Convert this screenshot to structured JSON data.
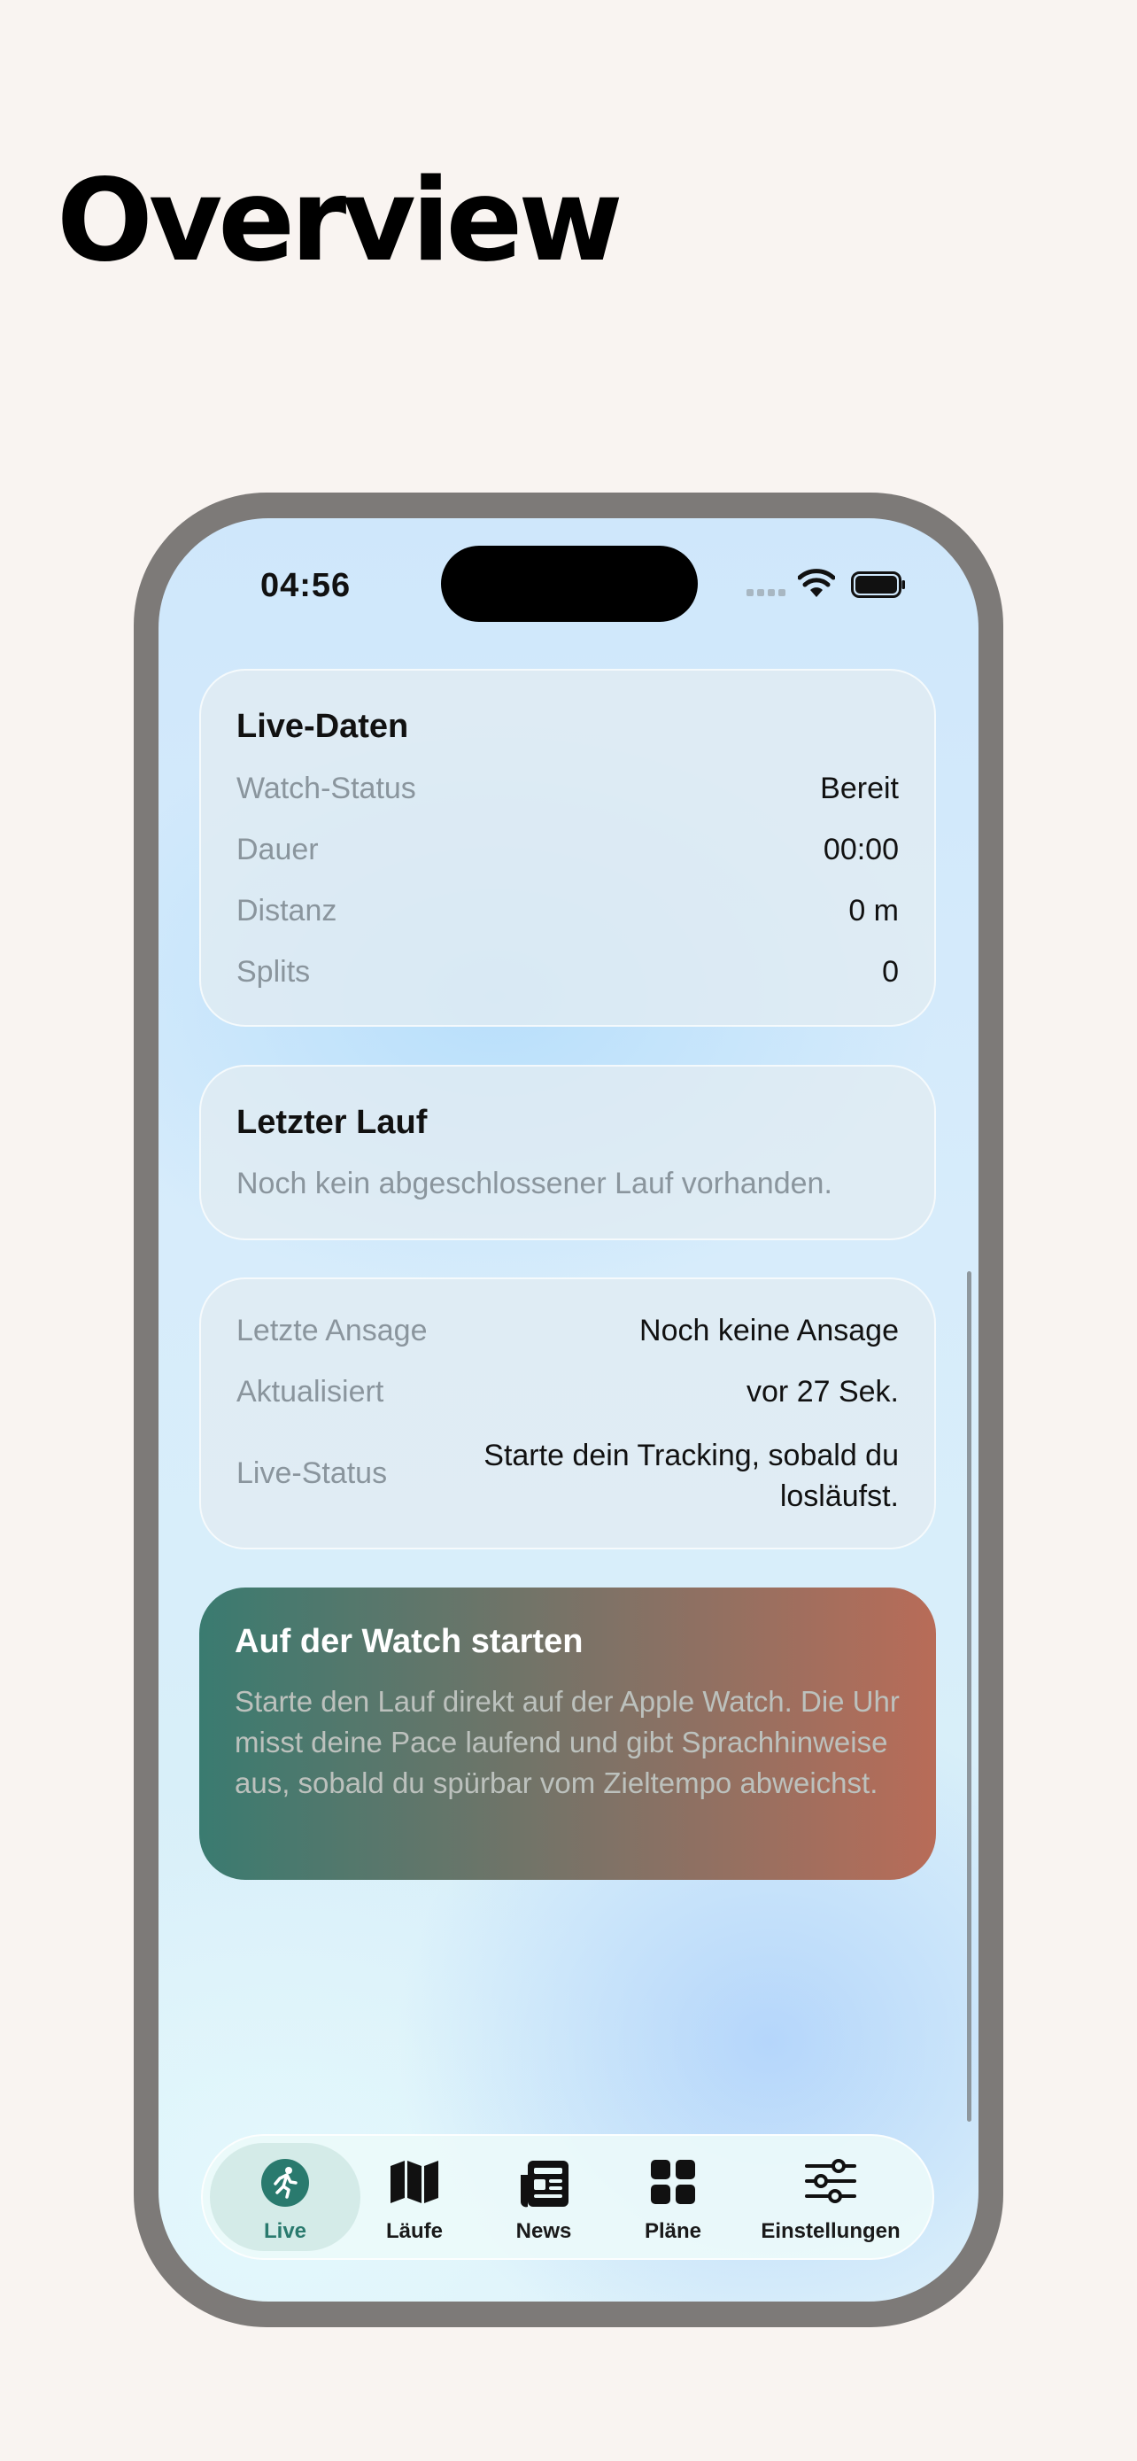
{
  "page": {
    "title": "Overview"
  },
  "status_bar": {
    "time": "04:56"
  },
  "live_card": {
    "title": "Live-Daten",
    "rows": [
      {
        "label": "Watch-Status",
        "value": "Bereit"
      },
      {
        "label": "Dauer",
        "value": "00:00"
      },
      {
        "label": "Distanz",
        "value": "0 m"
      },
      {
        "label": "Splits",
        "value": "0"
      }
    ]
  },
  "last_run_card": {
    "title": "Letzter Lauf",
    "empty_text": "Noch kein abgeschlossener Lauf vorhanden."
  },
  "announce_card": {
    "rows": [
      {
        "label": "Letzte Ansage",
        "value": "Noch keine Ansage"
      },
      {
        "label": "Aktualisiert",
        "value": "vor 27 Sek."
      },
      {
        "label": "Live-Status",
        "value_line1": "Starte dein Tracking, sobald du",
        "value_line2": "losläufst."
      }
    ]
  },
  "watch_card": {
    "title": "Auf der Watch starten",
    "description": "Starte den Lauf direkt auf der Apple Watch. Die Uhr misst deine Pace laufend und gibt Sprach­hinweise aus, sobald du spürbar vom Zieltempo abweichst."
  },
  "tab_bar": {
    "active": "Live",
    "tabs": [
      {
        "label": "Live",
        "icon": "runner-icon"
      },
      {
        "label": "Läufe",
        "icon": "map-icon"
      },
      {
        "label": "News",
        "icon": "newspaper-icon"
      },
      {
        "label": "Pläne",
        "icon": "grid-icon"
      },
      {
        "label": "Einstellungen",
        "icon": "sliders-icon"
      }
    ]
  },
  "colors": {
    "background": "#f9f4f1",
    "accent": "#2a7a6e",
    "watch_gradient_start": "#3a7b70",
    "watch_gradient_end": "#b86c58"
  }
}
